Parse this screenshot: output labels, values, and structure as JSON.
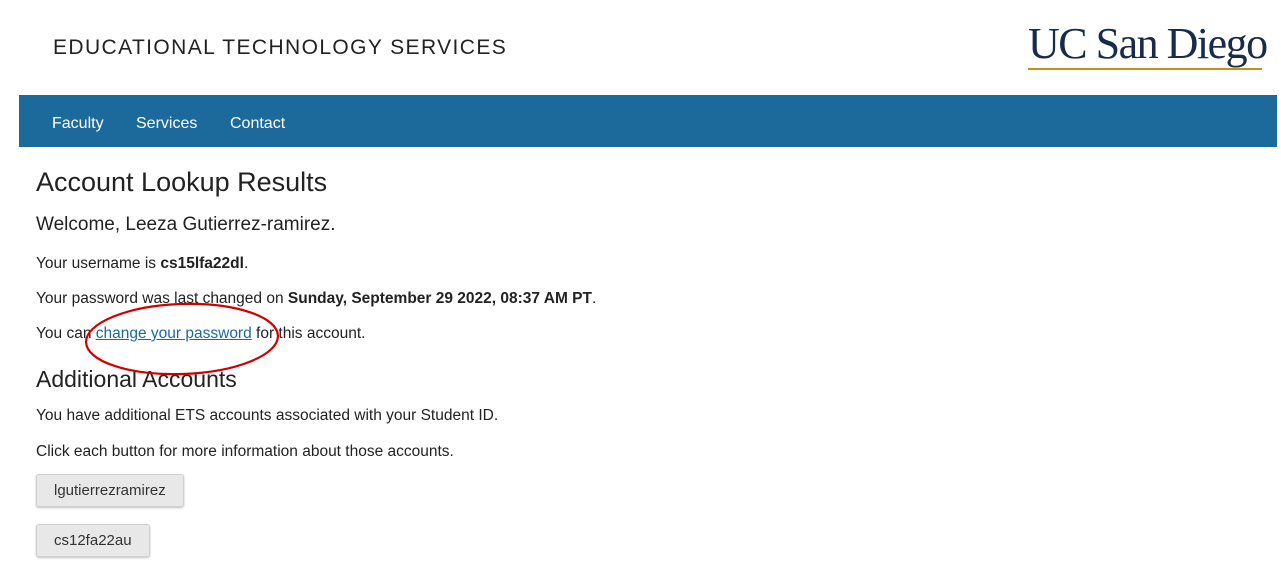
{
  "header": {
    "site_title": "EDUCATIONAL TECHNOLOGY SERVICES",
    "logo_text": "UC San Diego"
  },
  "nav": {
    "items": [
      {
        "label": "Faculty"
      },
      {
        "label": "Services"
      },
      {
        "label": "Contact"
      }
    ]
  },
  "main": {
    "title": "Account Lookup Results",
    "welcome": "Welcome, Leeza Gutierrez-ramirez.",
    "username_prefix": "Your username is ",
    "username": "cs15lfa22dl",
    "username_suffix": ".",
    "password_prefix": "Your password was last changed on ",
    "password_date": "Sunday, September 29 2022, 08:37 AM PT",
    "password_suffix": ".",
    "change_prefix": "You can ",
    "change_link": "change your password",
    "change_suffix": " for this account."
  },
  "additional": {
    "title": "Additional Accounts",
    "line1": "You have additional ETS accounts associated with your Student ID.",
    "line2": "Click each button for more information about those accounts.",
    "accounts": [
      {
        "label": "lgutierrezramirez"
      },
      {
        "label": "cs12fa22au"
      }
    ]
  },
  "colors": {
    "nav_bg": "#1b6a9b",
    "link": "#1b6a9b",
    "logo_navy": "#182b49",
    "logo_gold": "#c69214",
    "annotation_red": "#d00000"
  }
}
